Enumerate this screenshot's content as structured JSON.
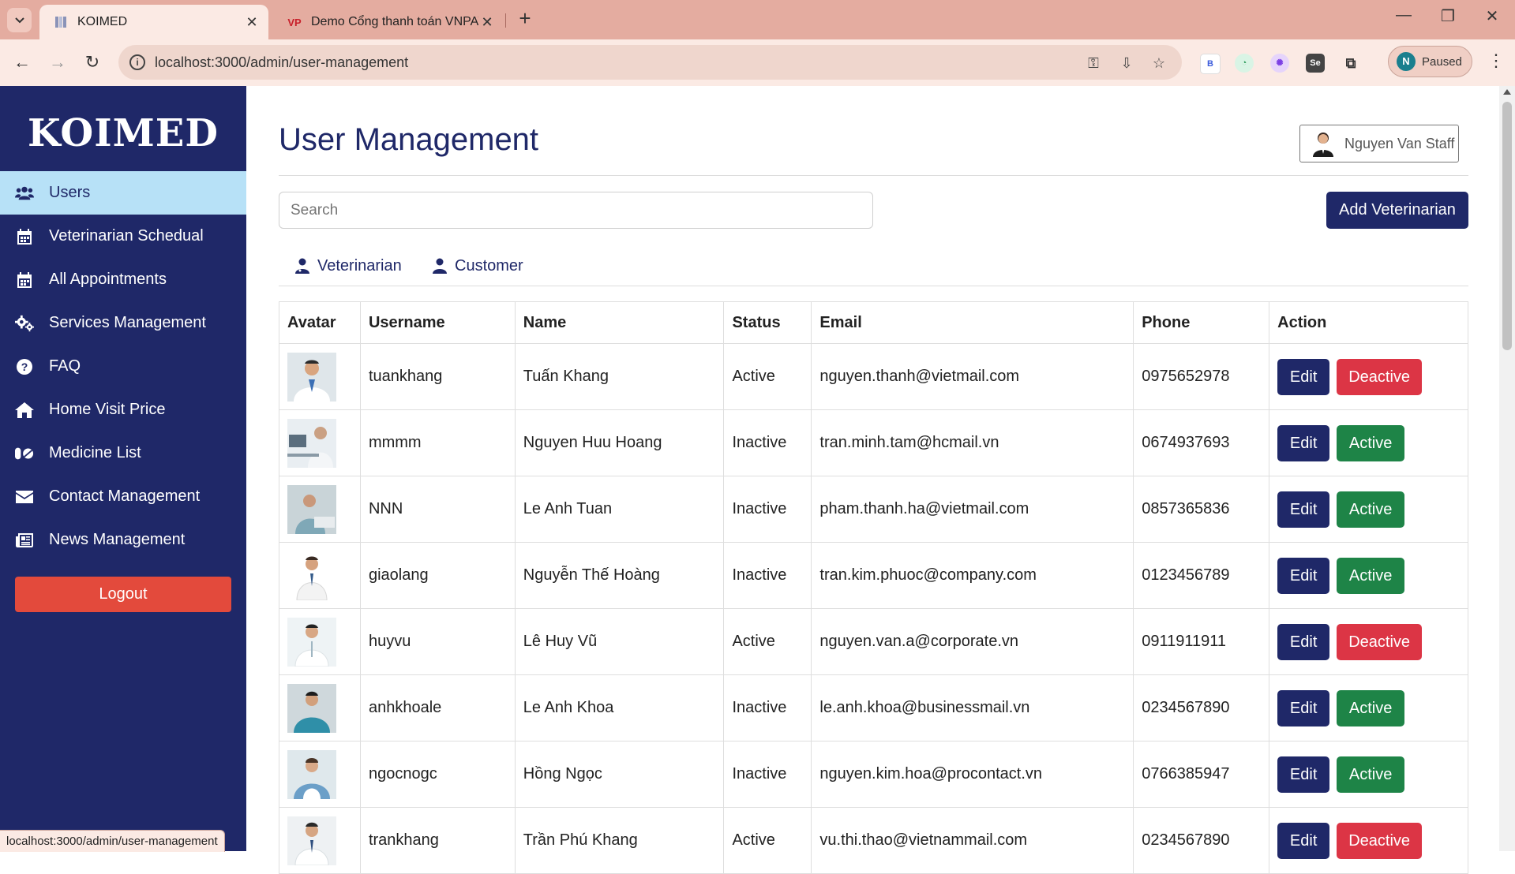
{
  "browser": {
    "tabs": [
      {
        "title": "KOIMED",
        "favicon": "koimed-favicon"
      },
      {
        "title": "Demo Cổng thanh toán VNPAY",
        "favicon": "VP"
      }
    ],
    "url": "localhost:3000/admin/user-management",
    "profile": {
      "initial": "N",
      "label": "Paused"
    },
    "extensions": [
      "B"
    ],
    "status_url": "localhost:3000/admin/user-management"
  },
  "sidebar": {
    "brand": "KOIMED",
    "items": [
      {
        "label": "Users",
        "icon": "users-icon"
      },
      {
        "label": "Veterinarian Schedual",
        "icon": "calendar-icon"
      },
      {
        "label": "All Appointments",
        "icon": "calendar-icon"
      },
      {
        "label": "Services Management",
        "icon": "gears-icon"
      },
      {
        "label": "FAQ",
        "icon": "question-icon"
      },
      {
        "label": "Home Visit Price",
        "icon": "home-icon"
      },
      {
        "label": "Medicine List",
        "icon": "pills-icon"
      },
      {
        "label": "Contact Management",
        "icon": "envelope-icon"
      },
      {
        "label": "News Management",
        "icon": "newspaper-icon"
      }
    ],
    "logout": "Logout"
  },
  "header": {
    "title": "User Management",
    "user_name": "Nguyen Van Staff"
  },
  "search": {
    "placeholder": "Search"
  },
  "actions": {
    "add": "Add Veterinarian"
  },
  "role_tabs": [
    {
      "label": "Veterinarian",
      "icon": "doctor-icon"
    },
    {
      "label": "Customer",
      "icon": "user-icon"
    }
  ],
  "table": {
    "columns": [
      "Avatar",
      "Username",
      "Name",
      "Status",
      "Email",
      "Phone",
      "Action"
    ],
    "edit_label": "Edit",
    "rows": [
      {
        "username": "tuankhang",
        "name": "Tuấn Khang",
        "status": "Active",
        "email": "nguyen.thanh@vietmail.com",
        "phone": "0975652978",
        "action": "Deactive"
      },
      {
        "username": "mmmm",
        "name": "Nguyen Huu Hoang",
        "status": "Inactive",
        "email": "tran.minh.tam@hcmail.vn",
        "phone": "0674937693",
        "action": "Active"
      },
      {
        "username": "NNN",
        "name": "Le Anh Tuan",
        "status": "Inactive",
        "email": "pham.thanh.ha@vietmail.com",
        "phone": "0857365836",
        "action": "Active"
      },
      {
        "username": "giaolang",
        "name": "Nguyễn Thế Hoàng",
        "status": "Inactive",
        "email": "tran.kim.phuoc@company.com",
        "phone": "0123456789",
        "action": "Active"
      },
      {
        "username": "huyvu",
        "name": "Lê Huy Vũ",
        "status": "Active",
        "email": "nguyen.van.a@corporate.vn",
        "phone": "0911911911",
        "action": "Deactive"
      },
      {
        "username": "anhkhoale",
        "name": "Le Anh Khoa",
        "status": "Inactive",
        "email": "le.anh.khoa@businessmail.vn",
        "phone": "0234567890",
        "action": "Active"
      },
      {
        "username": "ngocnogc",
        "name": "Hồng Ngọc",
        "status": "Inactive",
        "email": "nguyen.kim.hoa@procontact.vn",
        "phone": "0766385947",
        "action": "Active"
      },
      {
        "username": "trankhang",
        "name": "Trần Phú Khang",
        "status": "Active",
        "email": "vu.thi.thao@vietnammail.com",
        "phone": "0234567890",
        "action": "Deactive"
      }
    ]
  },
  "colors": {
    "sidebar": "#1f2868",
    "active_nav": "#b7e1f7",
    "deactive": "#dc3545",
    "activate": "#1e8447",
    "logout": "#e34a3c"
  }
}
